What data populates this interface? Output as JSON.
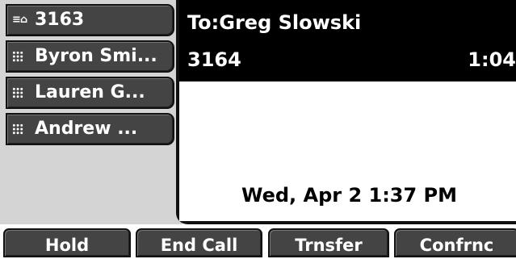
{
  "line_keys": [
    {
      "icon": "phone-line-icon",
      "icon_text": "⊶",
      "label": "3163"
    },
    {
      "icon": "grid-icon",
      "label": "Byron Smi..."
    },
    {
      "icon": "grid-icon",
      "label": "Lauren G..."
    },
    {
      "icon": "grid-icon",
      "label": "Andrew ..."
    }
  ],
  "call": {
    "to_label": "To:Greg Slowski",
    "number": "3164",
    "timer": "1:04"
  },
  "status": {
    "date_time": "Wed, Apr 2  1:37 PM"
  },
  "softkeys": [
    {
      "label": "Hold"
    },
    {
      "label": "End Call"
    },
    {
      "label": "Trnsfer"
    },
    {
      "label": "Confrnc"
    }
  ],
  "colors": {
    "key_bg": "#444444",
    "header_bg": "#000000",
    "panel_bg": "#d4d4d4"
  }
}
